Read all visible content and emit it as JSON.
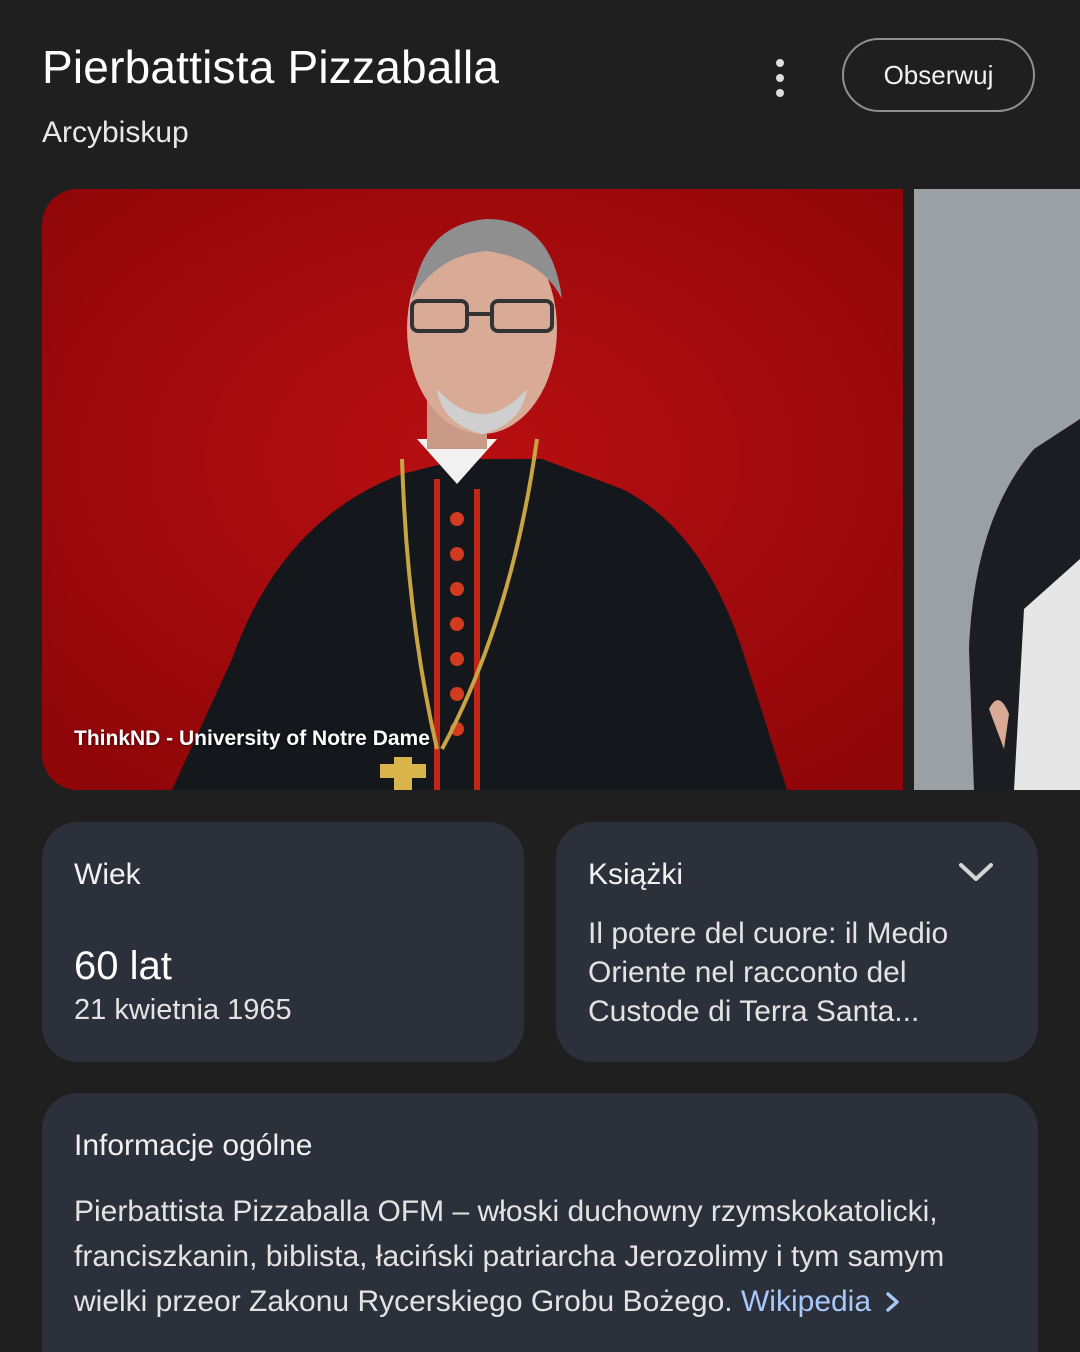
{
  "header": {
    "title": "Pierbattista Pizzaballa",
    "subtitle": "Arcybiskup",
    "follow_label": "Obserwuj",
    "more_icon": "more-vert-icon"
  },
  "images": {
    "main_credit": "ThinkND - University of Notre Dame",
    "main_background": "#a30a0c",
    "second_background": "#9aa0a4"
  },
  "age_card": {
    "label": "Wiek",
    "value": "60 lat",
    "date": "21 kwietnia 1965"
  },
  "books_card": {
    "label": "Książki",
    "text": "Il potere del cuore: il Medio Oriente nel racconto del Custode di Terra Santa...",
    "expand_icon": "chevron-down-icon"
  },
  "info_card": {
    "label": "Informacje ogólne",
    "text": "Pierbattista Pizzaballa OFM – włoski duchowny rzymskokatolicki, franciszkanin, biblista, łaciński patriarcha Jerozolimy i tym samym wielki przeor Zakonu Rycerskiego Grobu Bożego. ",
    "link_label": "Wikipedia",
    "link_color": "#a8c7fa"
  },
  "colors": {
    "background": "#1f1f1f",
    "card": "#2c303a"
  }
}
